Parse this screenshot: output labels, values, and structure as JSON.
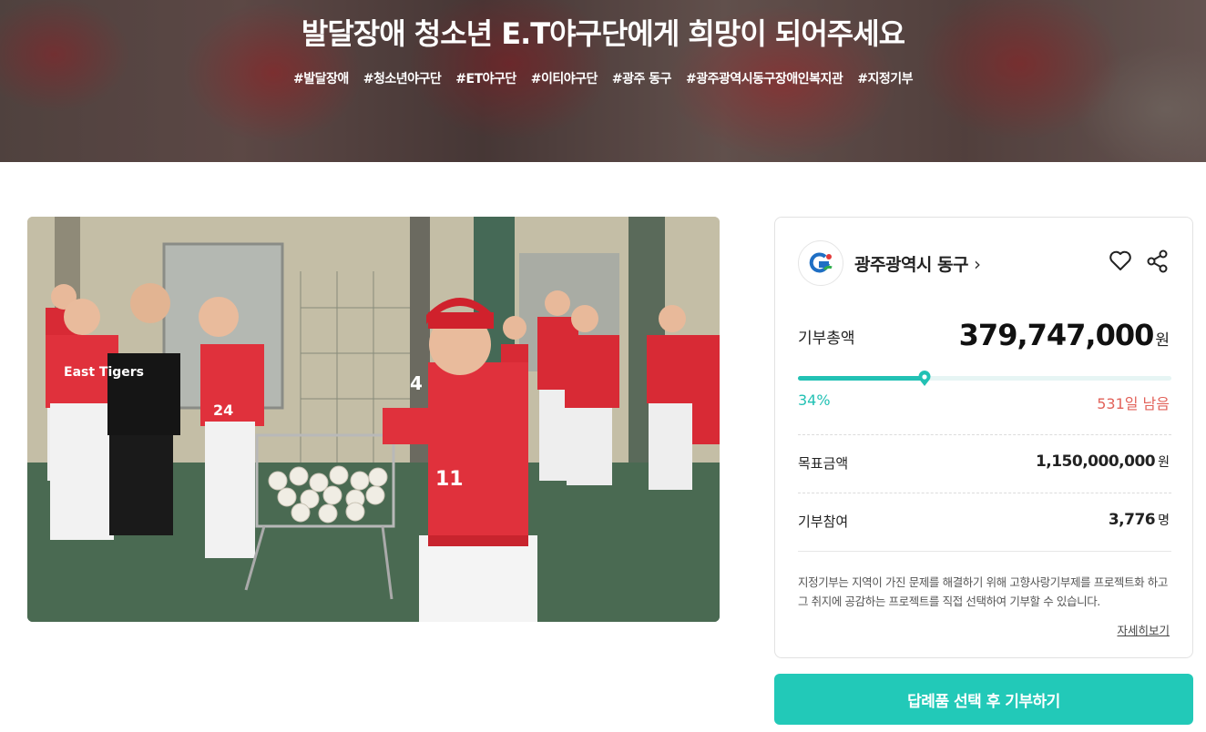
{
  "hero": {
    "title": "발달장애 청소년 E.T야구단에게 희망이 되어주세요",
    "tags": [
      "#발달장애",
      "#청소년야구단",
      "#ET야구단",
      "#이티야구단",
      "#광주 동구",
      "#광주광역시동구장애인복지관",
      "#지정기부"
    ]
  },
  "photo": {
    "jersey_text": "East Tigers",
    "numbers": [
      "24",
      "11",
      "4"
    ]
  },
  "card": {
    "org_name": "광주광역시 동구",
    "org_chevron": "›",
    "total_label": "기부총액",
    "total_value": "379,747,000",
    "total_unit": "원",
    "progress_percent": 34,
    "percent_text": "34%",
    "remaining_text": "531일 남음",
    "goal_label": "목표금액",
    "goal_value": "1,150,000,000",
    "goal_unit": "원",
    "participants_label": "기부참여",
    "participants_value": "3,776",
    "participants_unit": "명",
    "description": "지정기부는 지역이 가진 문제를 해결하기 위해 고향사랑기부제를 프로젝트화 하고 그 취지에 공감하는 프로젝트를 직접 선택하여 기부할 수 있습니다.",
    "more_link": "자세히보기"
  },
  "cta": {
    "label": "답례품 선택 후 기부하기"
  },
  "colors": {
    "accent": "#22c9b8",
    "remain": "#e2625a"
  }
}
